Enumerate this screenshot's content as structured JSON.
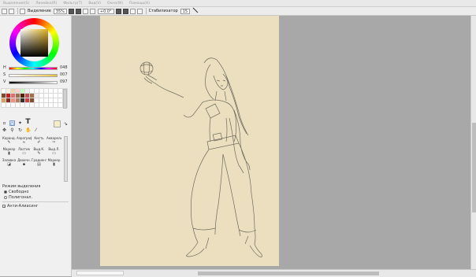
{
  "menu": [
    "Выделение(S)",
    "Линейка(R)",
    "Фильтр(T)",
    "Вид(V)",
    "Окно(W)",
    "Помощь(H)"
  ],
  "toolbar": {
    "selection_label": "Выделение",
    "zoom_value": "35%",
    "rotation_value": "+0.0°",
    "stabilizer_label": "Стабилизатор",
    "stabilizer_value": "15"
  },
  "color_sliders": [
    {
      "letter": "H",
      "value": "048",
      "gradient": "linear-gradient(to right,#f00,#ff0,#0f0,#0ff,#00f,#f0f,#f00)"
    },
    {
      "letter": "S",
      "value": "007",
      "gradient": "linear-gradient(to right,#ffffff,#e8c040)"
    },
    {
      "letter": "V",
      "value": "097",
      "gradient": "linear-gradient(to right,#000000,#ffffff)"
    }
  ],
  "swatch_colors": [
    "#ffffff",
    "#f5f0e0",
    "#e8d6b0",
    "#ffd0d0",
    "#c0ffc0",
    "#f0f0f0",
    "#ffffff",
    "#ffffff",
    "#ffffff",
    "#ffffff",
    "#ffffff",
    "#ffffff",
    "#ffffff",
    "#ffffff",
    "#7a4a2a",
    "#c02020",
    "#e07070",
    "#9a7050",
    "#502010",
    "#c05050",
    "#a07050",
    "#f0f0f0",
    "#ffffff",
    "#ffffff",
    "#ffffff",
    "#ffffff",
    "#ffffff",
    "#ffffff",
    "#d8a060",
    "#803020",
    "#f09080",
    "#b08060",
    "#303030",
    "#d04040",
    "#805030",
    "#ffffff",
    "#ffffff",
    "#ffffff",
    "#ffffff",
    "#ffffff",
    "#ffffff",
    "#ffffff",
    "#ffffff",
    "#ffffff",
    "#ffffff",
    "#ffffff",
    "#ffffff",
    "#ffffff",
    "#ffffff",
    "#ffffff",
    "#ffffff",
    "#ffffff",
    "#ffffff",
    "#ffffff",
    "#ffffff",
    "#ffffff"
  ],
  "brushes": [
    {
      "label": "Каранд.",
      "icon": "pencil-icon"
    },
    {
      "label": "Аэрограф",
      "icon": "airbrush-icon"
    },
    {
      "label": "Кисть",
      "icon": "brush-icon"
    },
    {
      "label": "Акварель",
      "icon": "watercolor-icon"
    },
    {
      "label": "Маркер",
      "icon": "marker-icon"
    },
    {
      "label": "Ластик",
      "icon": "eraser-icon"
    },
    {
      "label": "Выд.К.",
      "icon": "select-pen-icon"
    },
    {
      "label": "Выд.Л.",
      "icon": "select-eraser-icon"
    },
    {
      "label": "Заливка",
      "icon": "fill-icon"
    },
    {
      "label": "Двоичн.",
      "icon": "binary-icon"
    },
    {
      "label": "Градиент",
      "icon": "gradient-icon"
    },
    {
      "label": "Маркер",
      "icon": "marker2-icon"
    }
  ],
  "selection_mode": {
    "title": "Режим выделения",
    "options": [
      "Свободно",
      "Полигонал."
    ],
    "selected": 0
  },
  "antialias_label": "Анти-Алиасинг"
}
